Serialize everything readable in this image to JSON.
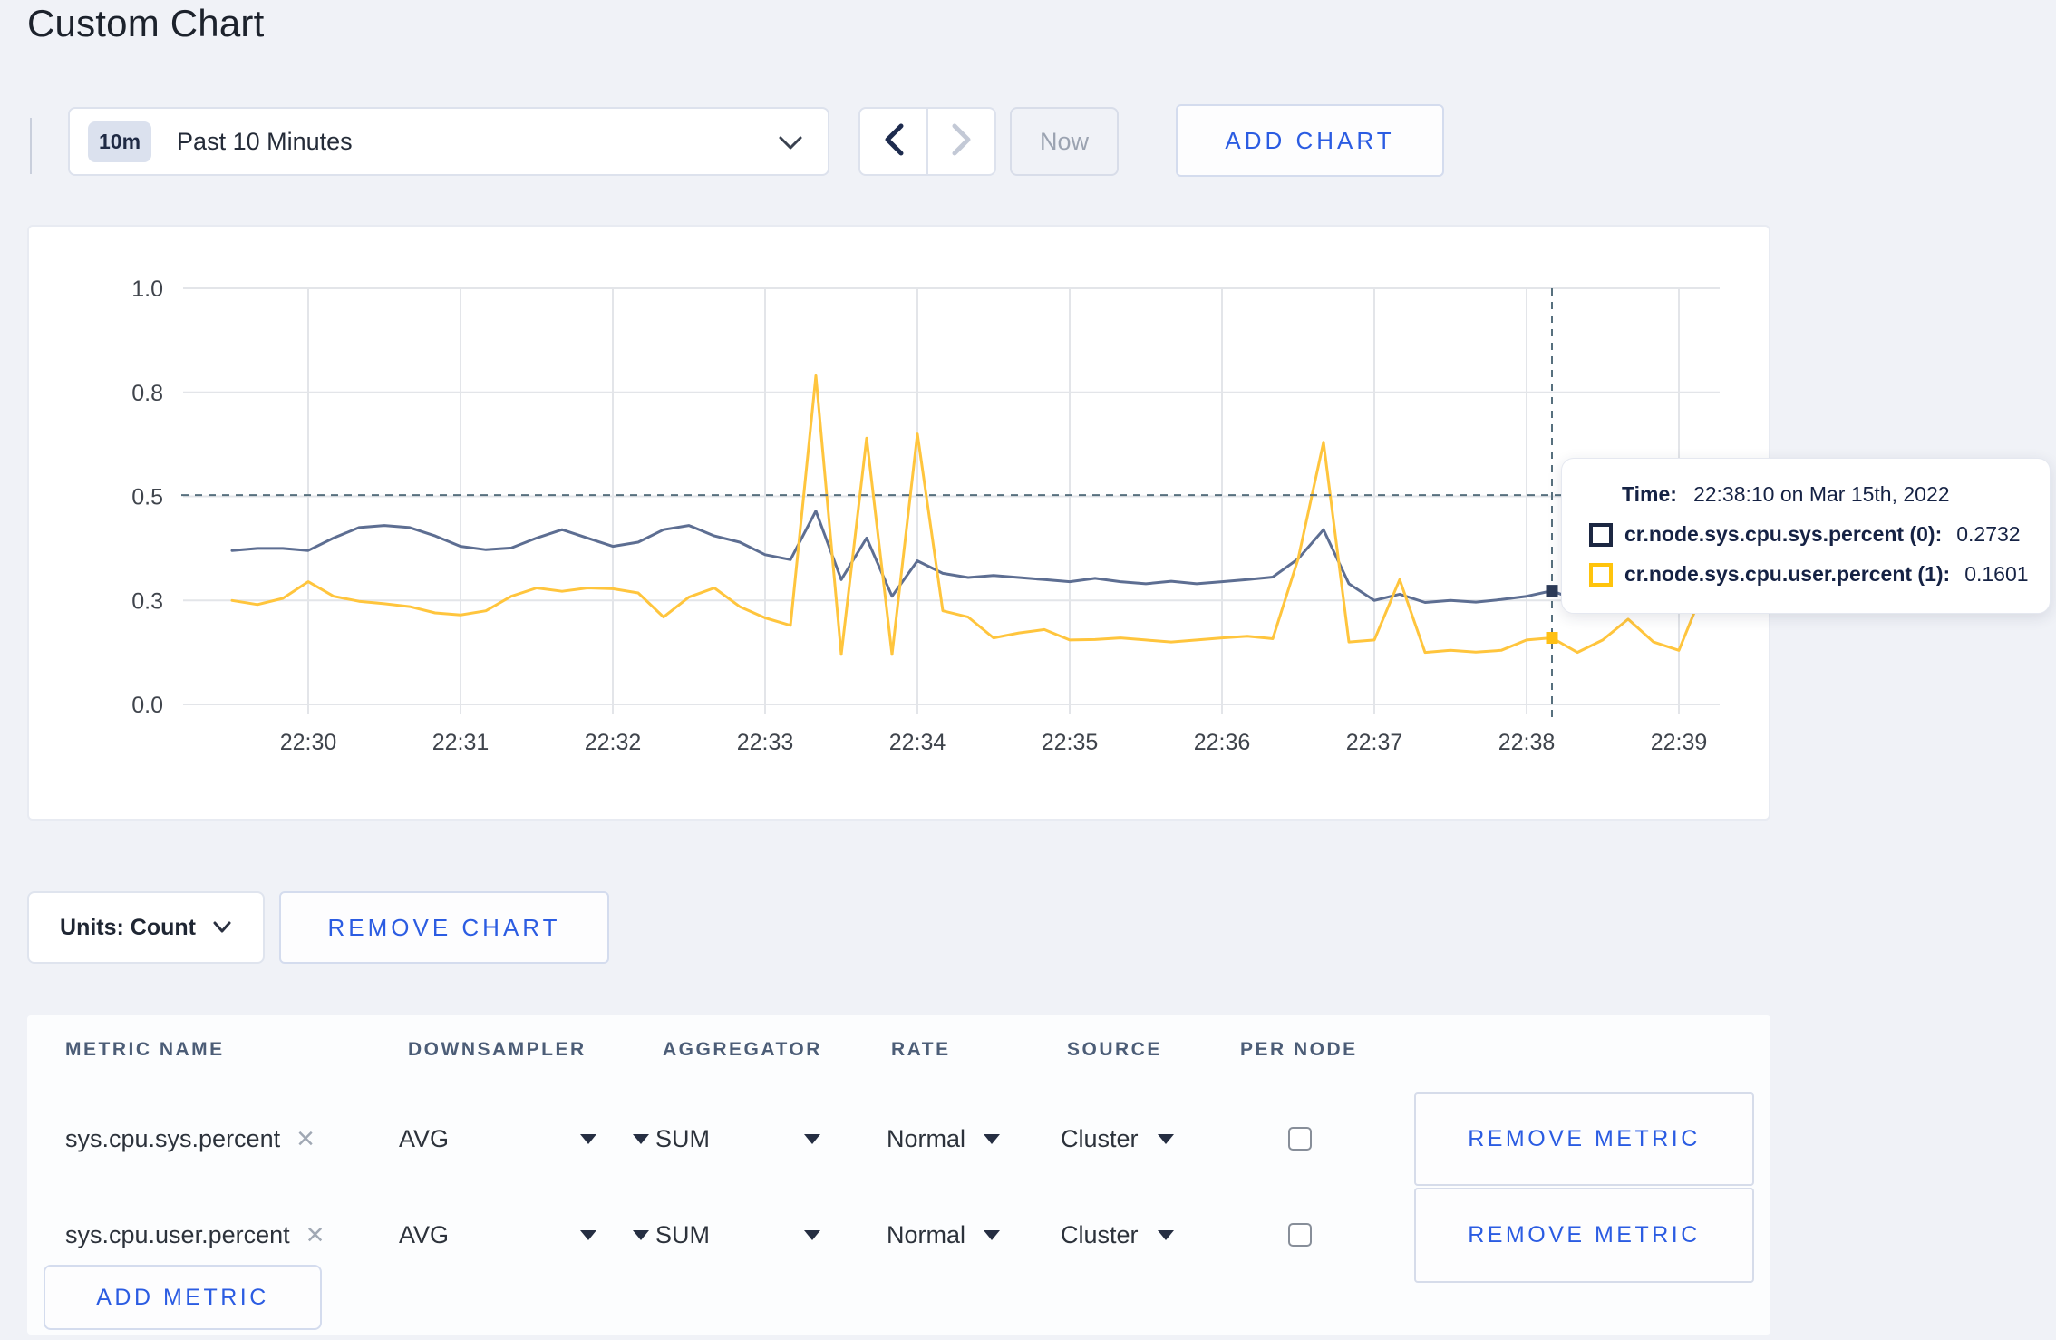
{
  "page": {
    "title": "Custom Chart"
  },
  "toolbar": {
    "time_badge": "10m",
    "time_label": "Past 10 Minutes",
    "now_label": "Now",
    "add_chart_label": "ADD CHART"
  },
  "chart_controls": {
    "units_label": "Units: Count",
    "remove_chart_label": "REMOVE CHART"
  },
  "tooltip": {
    "time_label": "Time:",
    "time_value": "22:38:10 on Mar 15th, 2022",
    "entries": [
      {
        "label": "cr.node.sys.cpu.sys.percent (0):",
        "value": "0.2732",
        "swatch": "#1c2742"
      },
      {
        "label": "cr.node.sys.cpu.user.percent (1):",
        "value": "0.1601",
        "swatch": "#ffc40c"
      }
    ]
  },
  "metrics_table": {
    "headers": [
      "METRIC NAME",
      "DOWNSAMPLER",
      "AGGREGATOR",
      "RATE",
      "SOURCE",
      "PER NODE"
    ],
    "rows": [
      {
        "metric": "sys.cpu.sys.percent",
        "downsampler": "AVG",
        "aggregator": "SUM",
        "rate": "Normal",
        "source": "Cluster",
        "per_node_checked": false,
        "remove_label": "REMOVE METRIC"
      },
      {
        "metric": "sys.cpu.user.percent",
        "downsampler": "AVG",
        "aggregator": "SUM",
        "rate": "Normal",
        "source": "Cluster",
        "per_node_checked": false,
        "remove_label": "REMOVE METRIC"
      }
    ],
    "add_metric_label": "ADD METRIC"
  },
  "icons": {
    "remove_x": "×"
  },
  "chart_data": {
    "type": "line",
    "title": "",
    "xlabel": "",
    "ylabel": "",
    "x_start": "22:29:30",
    "x_interval_seconds": 10,
    "x_tick_labels": [
      "22:30",
      "22:31",
      "22:32",
      "22:33",
      "22:34",
      "22:35",
      "22:36",
      "22:37",
      "22:38",
      "22:39"
    ],
    "y_tick_labels": [
      "0.0",
      "0.3",
      "0.5",
      "0.8",
      "1.0"
    ],
    "y_tick_values": [
      0,
      0.25,
      0.5,
      0.75,
      1.0
    ],
    "ylim": [
      0,
      1
    ],
    "grid": true,
    "legend_position": "tooltip",
    "series": [
      {
        "name": "cr.node.sys.cpu.sys.percent",
        "color": "#5d6e92",
        "marker_color": "#2c3a57",
        "values": [
          0.37,
          0.375,
          0.375,
          0.37,
          0.4,
          0.425,
          0.43,
          0.425,
          0.405,
          0.38,
          0.372,
          0.376,
          0.4,
          0.42,
          0.4,
          0.38,
          0.39,
          0.42,
          0.43,
          0.405,
          0.39,
          0.36,
          0.348,
          0.465,
          0.3,
          0.4,
          0.26,
          0.345,
          0.315,
          0.305,
          0.31,
          0.305,
          0.3,
          0.295,
          0.303,
          0.295,
          0.29,
          0.296,
          0.29,
          0.295,
          0.3,
          0.306,
          0.35,
          0.42,
          0.29,
          0.25,
          0.265,
          0.245,
          0.25,
          0.246,
          0.252,
          0.26,
          0.2732,
          0.25,
          0.255,
          0.26,
          0.295,
          0.31,
          0.298,
          0.305
        ]
      },
      {
        "name": "cr.node.sys.cpu.user.percent",
        "color": "#ffc53d",
        "marker_color": "#ffc014",
        "values": [
          0.25,
          0.24,
          0.255,
          0.295,
          0.26,
          0.248,
          0.242,
          0.235,
          0.22,
          0.215,
          0.225,
          0.26,
          0.28,
          0.272,
          0.28,
          0.278,
          0.268,
          0.21,
          0.258,
          0.28,
          0.235,
          0.208,
          0.19,
          0.79,
          0.12,
          0.64,
          0.12,
          0.65,
          0.225,
          0.21,
          0.16,
          0.172,
          0.18,
          0.155,
          0.156,
          0.16,
          0.155,
          0.15,
          0.155,
          0.16,
          0.164,
          0.158,
          0.35,
          0.63,
          0.15,
          0.155,
          0.3,
          0.125,
          0.13,
          0.126,
          0.13,
          0.155,
          0.1601,
          0.125,
          0.155,
          0.205,
          0.15,
          0.13,
          0.28,
          0.26
        ]
      }
    ],
    "crosshair": {
      "index": 52,
      "time": "22:38:10",
      "y_fraction": 0.503
    }
  }
}
